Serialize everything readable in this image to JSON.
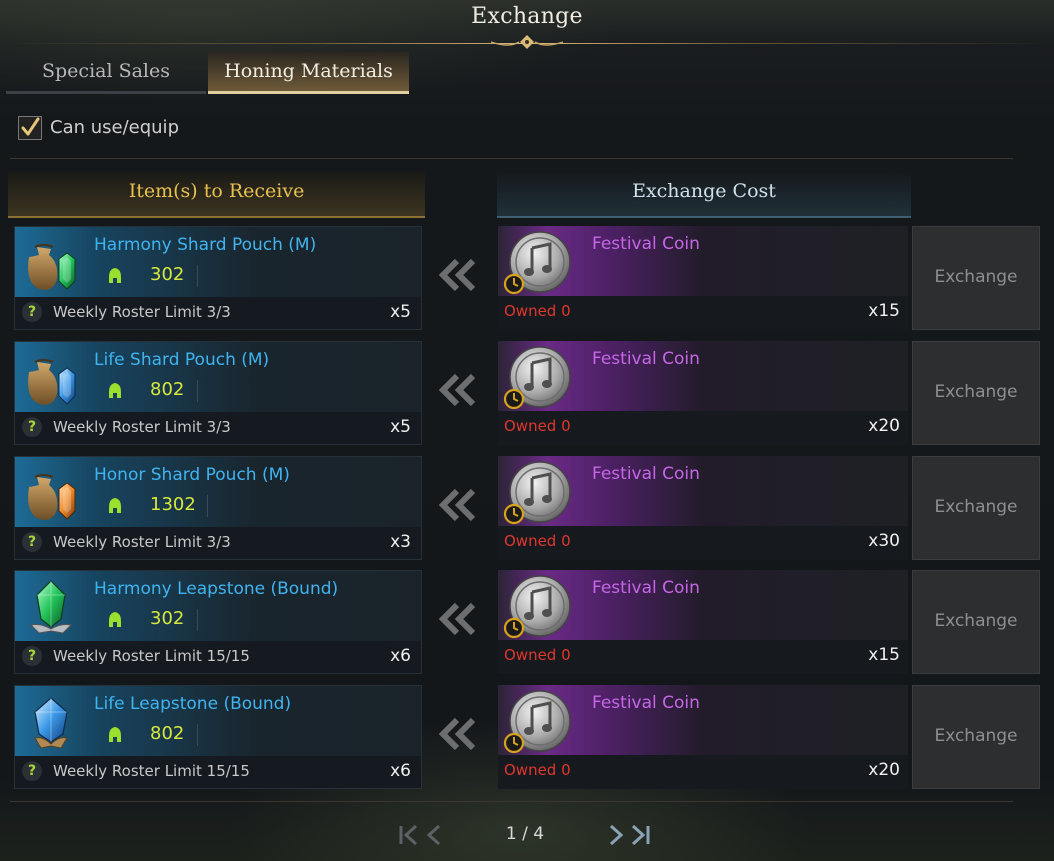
{
  "window": {
    "title": "Exchange"
  },
  "tabs": [
    {
      "label": "Special Sales",
      "active": false
    },
    {
      "label": "Honing Materials",
      "active": true
    }
  ],
  "filter": {
    "label": "Can use/equip",
    "checked": true
  },
  "columns": {
    "receive": "Item(s) to Receive",
    "cost": "Exchange Cost"
  },
  "rows": [
    {
      "item": {
        "name": "Harmony Shard Pouch (M)",
        "icon": "harmony-shard-pouch-icon",
        "level": "302",
        "limit": "Weekly Roster Limit 3/3",
        "qty": "x5"
      },
      "cost": {
        "name": "Festival Coin",
        "icon": "festival-coin-icon",
        "owned": "Owned 0",
        "qty": "x15"
      },
      "button": "Exchange"
    },
    {
      "item": {
        "name": "Life Shard Pouch (M)",
        "icon": "life-shard-pouch-icon",
        "level": "802",
        "limit": "Weekly Roster Limit 3/3",
        "qty": "x5"
      },
      "cost": {
        "name": "Festival Coin",
        "icon": "festival-coin-icon",
        "owned": "Owned 0",
        "qty": "x20"
      },
      "button": "Exchange"
    },
    {
      "item": {
        "name": "Honor Shard Pouch (M)",
        "icon": "honor-shard-pouch-icon",
        "level": "1302",
        "limit": "Weekly Roster Limit 3/3",
        "qty": "x3"
      },
      "cost": {
        "name": "Festival Coin",
        "icon": "festival-coin-icon",
        "owned": "Owned 0",
        "qty": "x30"
      },
      "button": "Exchange"
    },
    {
      "item": {
        "name": "Harmony Leapstone (Bound)",
        "icon": "harmony-leapstone-icon",
        "level": "302",
        "limit": "Weekly Roster Limit 15/15",
        "qty": "x6"
      },
      "cost": {
        "name": "Festival Coin",
        "icon": "festival-coin-icon",
        "owned": "Owned 0",
        "qty": "x15"
      },
      "button": "Exchange"
    },
    {
      "item": {
        "name": "Life Leapstone (Bound)",
        "icon": "life-leapstone-icon",
        "level": "802",
        "limit": "Weekly Roster Limit 15/15",
        "qty": "x6"
      },
      "cost": {
        "name": "Festival Coin",
        "icon": "festival-coin-icon",
        "owned": "Owned 0",
        "qty": "x20"
      },
      "button": "Exchange"
    }
  ],
  "pagination": {
    "label": "1 / 4"
  },
  "colors": {
    "item_name": "#3fb4f0",
    "level": "#d8e83c",
    "cost_name": "#c766e6",
    "owned": "#e0372e",
    "receive_header": "#e8c14e"
  }
}
